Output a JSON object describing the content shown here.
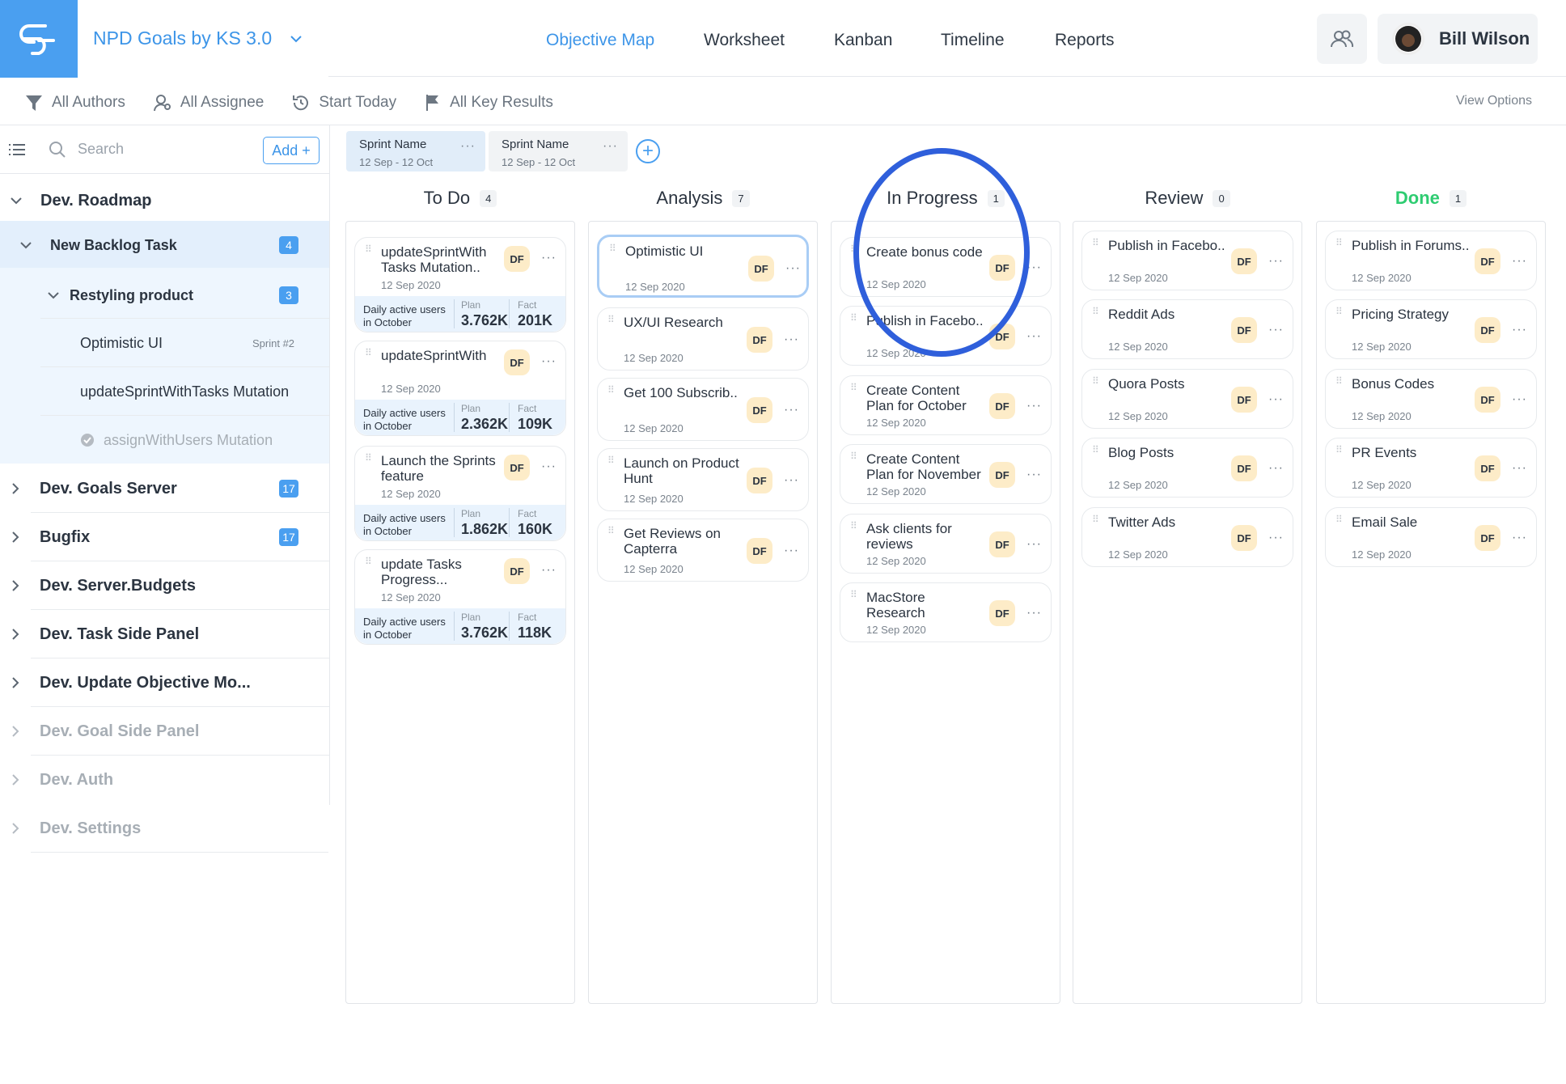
{
  "header": {
    "project_title": "NPD Goals by KS 3.0",
    "nav": [
      "Objective Map",
      "Worksheet",
      "Kanban",
      "Timeline",
      "Reports"
    ],
    "active_nav": "Objective Map",
    "user_name": "Bill Wilson"
  },
  "filters": {
    "authors": "All Authors",
    "assignee": "All Assignee",
    "start": "Start Today",
    "key_results": "All Key Results",
    "view_options": "View Options"
  },
  "sidebar": {
    "search_placeholder": "Search",
    "add_label": "Add +",
    "items": [
      {
        "label": "Dev. Roadmap"
      },
      {
        "label": "New Backlog Task",
        "badge": "4"
      },
      {
        "label": "Restyling product",
        "badge": "3"
      },
      {
        "label": "Optimistic UI",
        "tag": "Sprint #2"
      },
      {
        "label": "updateSprintWithTasks Mutation"
      },
      {
        "label": "assignWithUsers Mutation"
      },
      {
        "label": "Dev. Goals Server",
        "badge": "17"
      },
      {
        "label": "Bugfix",
        "badge": "17"
      },
      {
        "label": "Dev. Server.Budgets"
      },
      {
        "label": "Dev. Task Side Panel"
      },
      {
        "label": "Dev. Update Objective Mo..."
      },
      {
        "label": "Dev. Goal Side Panel"
      },
      {
        "label": "Dev. Auth"
      },
      {
        "label": "Dev. Settings"
      }
    ]
  },
  "sprints": [
    {
      "name": "Sprint Name",
      "dates": "12 Sep - 12 Oct"
    },
    {
      "name": "Sprint Name",
      "dates": "12 Sep - 12 Oct"
    }
  ],
  "columns": [
    {
      "title": "To Do",
      "count": "4",
      "cards": [
        {
          "title": "updateSprintWith Tasks Mutation..",
          "date": "12 Sep 2020",
          "metric": "Daily active users in October",
          "plan": "3.762K",
          "fact": "201K"
        },
        {
          "title": "updateSprintWith",
          "date": "12 Sep 2020",
          "metric": "Daily active users in October",
          "plan": "2.362K",
          "fact": "109K"
        },
        {
          "title": "Launch the Sprints feature",
          "date": "12 Sep 2020",
          "metric": "Daily active users in October",
          "plan": "1.862K",
          "fact": "160K"
        },
        {
          "title": "update Tasks Progress...",
          "date": "12 Sep 2020",
          "metric": "Daily active users in October",
          "plan": "3.762K",
          "fact": "118K"
        }
      ]
    },
    {
      "title": "Analysis",
      "count": "7",
      "cards": [
        {
          "title": "Optimistic UI",
          "date": "12 Sep 2020"
        },
        {
          "title": "UX/UI Research",
          "date": "12 Sep 2020"
        },
        {
          "title": "Get 100 Subscrib..",
          "date": "12 Sep 2020"
        },
        {
          "title": "Launch on Product Hunt",
          "date": "12 Sep 2020"
        },
        {
          "title": "Get Reviews on Capterra",
          "date": "12 Sep 2020"
        }
      ]
    },
    {
      "title": "In Progress",
      "count": "1",
      "cards": [
        {
          "title": "Create bonus code",
          "date": "12 Sep 2020"
        },
        {
          "title": "Publish in Facebo..",
          "date": "12 Sep 2020"
        },
        {
          "title": "Create Content Plan for October",
          "date": "12 Sep 2020"
        },
        {
          "title": "Create Content Plan for November",
          "date": "12 Sep 2020"
        },
        {
          "title": "Ask clients for reviews",
          "date": "12 Sep 2020"
        },
        {
          "title": "MacStore Research",
          "date": "12 Sep 2020"
        }
      ]
    },
    {
      "title": "Review",
      "count": "0",
      "cards": [
        {
          "title": "Publish in Facebo..",
          "date": "12 Sep 2020"
        },
        {
          "title": "Reddit Ads",
          "date": "12 Sep 2020"
        },
        {
          "title": "Quora Posts",
          "date": "12 Sep 2020"
        },
        {
          "title": "Blog Posts",
          "date": "12 Sep 2020"
        },
        {
          "title": "Twitter Ads",
          "date": "12 Sep 2020"
        }
      ]
    },
    {
      "title": "Done",
      "count": "1",
      "cards": [
        {
          "title": "Publish in Forums..",
          "date": "12 Sep 2020"
        },
        {
          "title": "Pricing Strategy",
          "date": "12 Sep 2020"
        },
        {
          "title": "Bonus Codes",
          "date": "12 Sep 2020"
        },
        {
          "title": "PR Events",
          "date": "12 Sep 2020"
        },
        {
          "title": "Email Sale",
          "date": "12 Sep 2020"
        }
      ]
    }
  ],
  "labels": {
    "avatar_initials": "DF",
    "plan": "Plan",
    "fact": "Fact"
  },
  "colors": {
    "accent": "#4a9ff0",
    "done": "#2ecc71",
    "annotation": "#2f5fdb"
  }
}
